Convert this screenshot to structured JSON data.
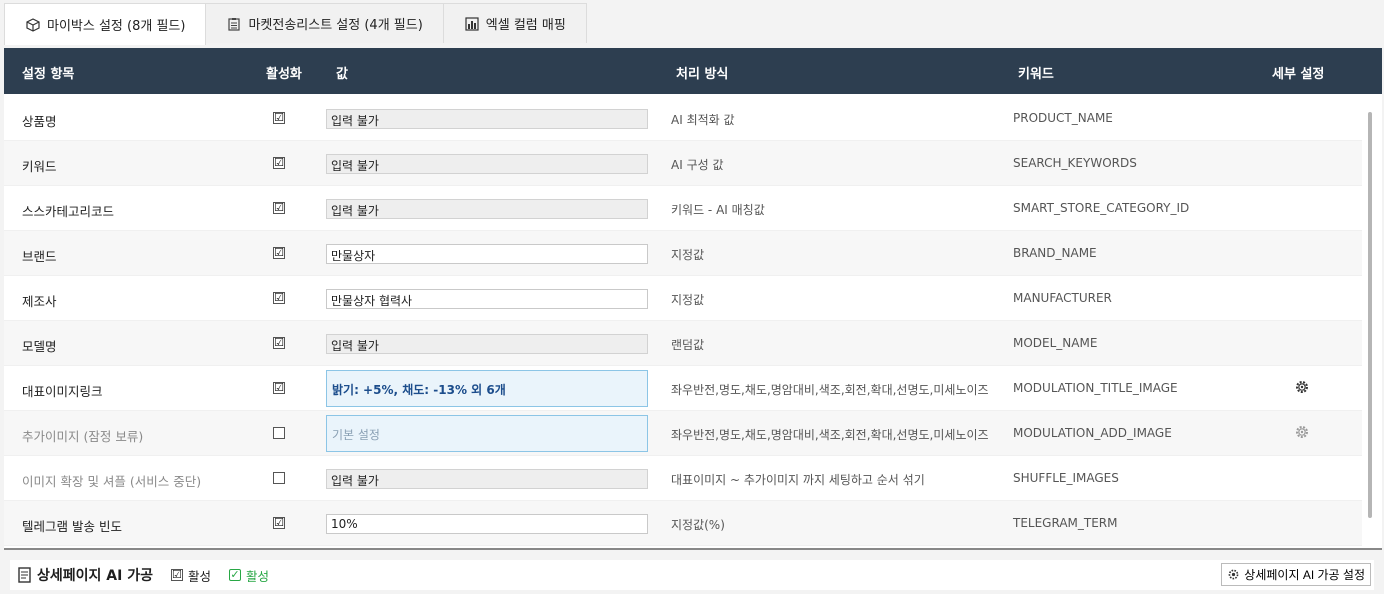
{
  "tabs": [
    {
      "label": "마이박스 설정 (8개 필드)",
      "icon": "package-icon",
      "active": true
    },
    {
      "label": "마켓전송리스트 설정 (4개 필드)",
      "icon": "clipboard-icon",
      "active": false
    },
    {
      "label": "엑셀 컬럼 매핑",
      "icon": "bar-chart-icon",
      "active": false
    }
  ],
  "header": {
    "col_item": "설정 항목",
    "col_active": "활성화",
    "col_value": "값",
    "col_process": "처리 방식",
    "col_keyword": "키워드",
    "col_detail": "세부 설정"
  },
  "rows": [
    {
      "name": "상품명",
      "checked": "☑",
      "value": "입력 불가",
      "process": "AI 최적화 값",
      "keyword": "PRODUCT_NAME"
    },
    {
      "name": "키워드",
      "checked": "☑",
      "value": "입력 불가",
      "process": "AI 구성 값",
      "keyword": "SEARCH_KEYWORDS"
    },
    {
      "name": "스스카테고리코드",
      "checked": "☑",
      "value": "입력 불가",
      "process": "키워드 - AI 매칭값",
      "keyword": "SMART_STORE_CATEGORY_ID"
    },
    {
      "name": "브랜드",
      "checked": "☑",
      "value": "만물상자",
      "process": "지정값",
      "keyword": "BRAND_NAME"
    },
    {
      "name": "제조사",
      "checked": "☑",
      "value": "만물상자 협력사",
      "process": "지정값",
      "keyword": "MANUFACTURER"
    },
    {
      "name": "모델명",
      "checked": "☑",
      "value": "입력 불가",
      "process": "랜덤값",
      "keyword": "MODEL_NAME"
    },
    {
      "name": "대표이미지링크",
      "checked": "☑",
      "value": "밝기: +5%, 채도: -13% 외 6개",
      "process": "좌우반전,명도,채도,명암대비,색조,회전,확대,선명도,미세노이즈",
      "keyword": "MODULATION_TITLE_IMAGE"
    },
    {
      "name": "추가이미지 (잠정 보류)",
      "checked": "",
      "value": "기본 설정",
      "process": "좌우반전,명도,채도,명암대비,색조,회전,확대,선명도,미세노이즈",
      "keyword": "MODULATION_ADD_IMAGE"
    },
    {
      "name": "이미지 확장 및 셔플 (서비스 중단)",
      "checked": "",
      "value": "입력 불가",
      "process": "대표이미지 ~ 추가이미지 까지 세팅하고 순서 섞기",
      "keyword": "SHUFFLE_IMAGES"
    },
    {
      "name": "텔레그램 발송 빈도",
      "checked": "☑",
      "value": "10%",
      "process": "지정값(%)",
      "keyword": "TELEGRAM_TERM"
    }
  ],
  "footer": {
    "title": "상세페이지 AI 가공",
    "check1_label": "활성",
    "check1_mark": "☑",
    "check2_label": "활성",
    "check2_mark": "✓",
    "settings_button": "상세페이지 AI 가공 설정"
  },
  "colors": {
    "header_bg": "#2d3e50",
    "accent_blue": "#1c4d8c",
    "active_green": "#28a745"
  }
}
